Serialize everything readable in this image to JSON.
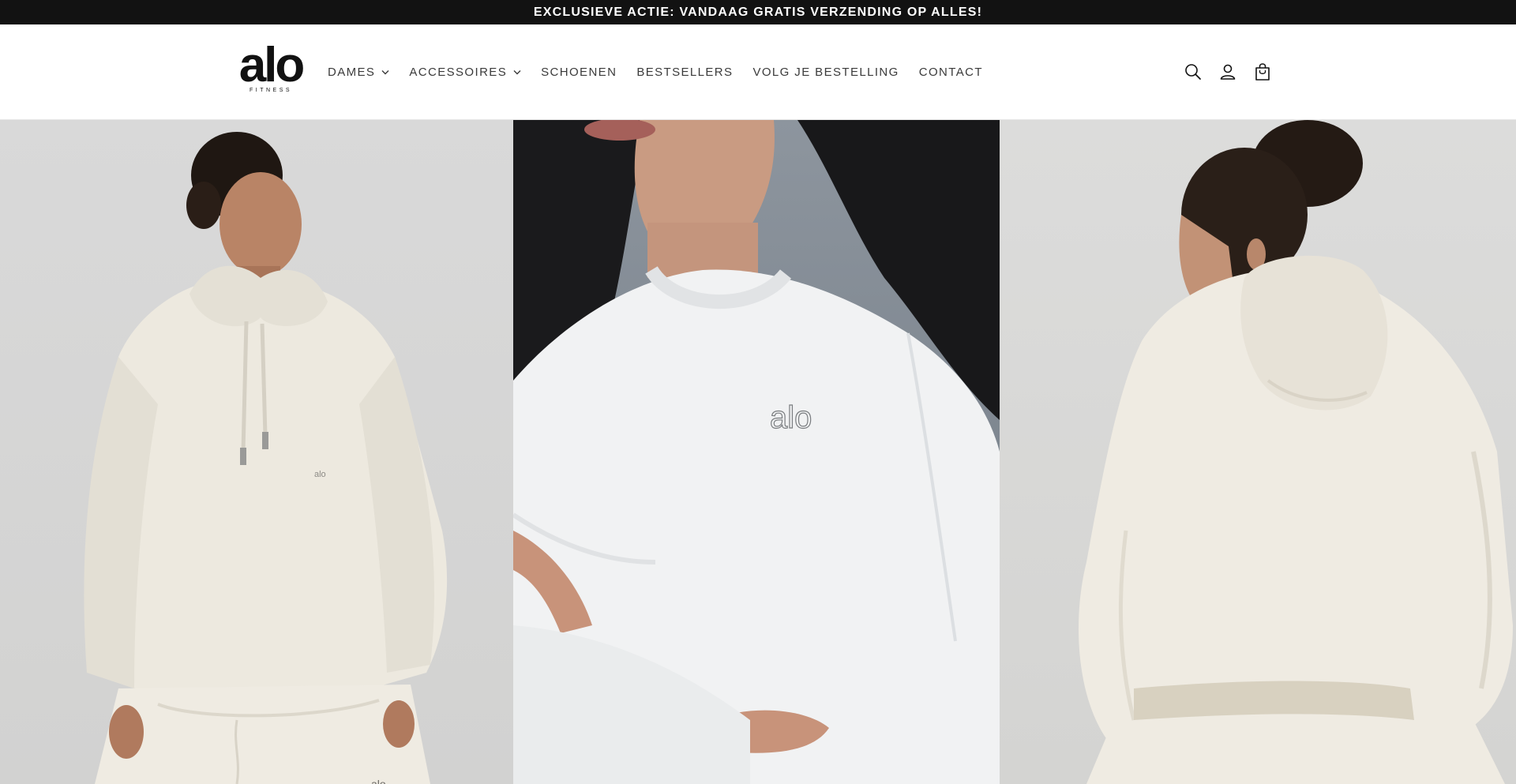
{
  "announcement": {
    "text": "EXCLUSIEVE ACTIE: VANDAAG GRATIS VERZENDING OP ALLES!"
  },
  "header": {
    "logo": {
      "main": "alo",
      "sub": "FITNESS"
    },
    "nav": [
      {
        "label": "DAMES",
        "has_dropdown": true
      },
      {
        "label": "ACCESSOIRES",
        "has_dropdown": true
      },
      {
        "label": "SCHOENEN",
        "has_dropdown": false
      },
      {
        "label": "BESTSELLERS",
        "has_dropdown": false
      },
      {
        "label": "VOLG JE BESTELLING",
        "has_dropdown": false
      },
      {
        "label": "CONTACT",
        "has_dropdown": false
      }
    ],
    "icons": [
      "search-icon",
      "account-icon",
      "cart-icon"
    ]
  },
  "hero": {
    "panels": [
      {
        "name": "model-front-hoodie-and-pants",
        "garment_logo": "alo",
        "background": "#d6d6d5"
      },
      {
        "name": "model-closeup-white-sweatshirt",
        "garment_logo": "alo",
        "background": "#7f8891"
      },
      {
        "name": "model-back-hoodie",
        "background": "#d8d8d6"
      }
    ]
  },
  "colors": {
    "announcement_bg": "#121212",
    "announcement_text": "#ffffff",
    "nav_text": "#3a3a3a",
    "garment_cream": "#efebe2",
    "garment_white": "#f1f2f3"
  }
}
